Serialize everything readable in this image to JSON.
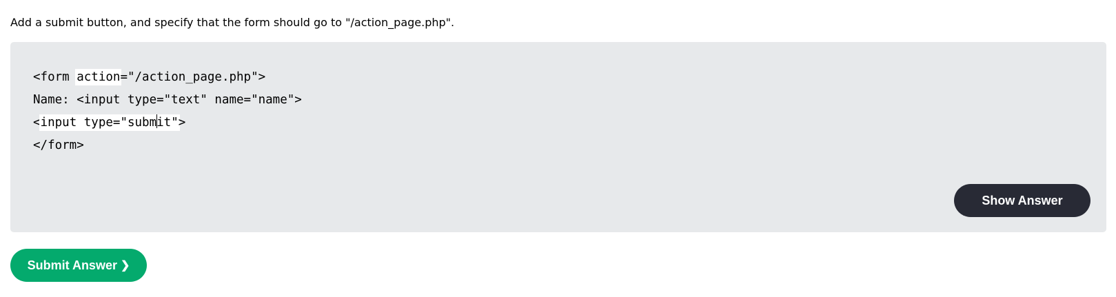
{
  "exercise": {
    "instruction": "Add a submit button, and specify that the form should go to \"/action_page.php\"."
  },
  "code": {
    "line1_start": "<form ",
    "input1_value": "action",
    "line1_end": "=\"/action_page.php\">",
    "line2": "Name: <input type=\"text\" name=\"name\">",
    "line3_start": "<",
    "input2_before_caret": "input type=\"subm",
    "input2_after_caret": "it\"",
    "line3_end": ">",
    "line4": "</form>"
  },
  "buttons": {
    "show_answer": "Show Answer",
    "submit_answer": "Submit Answer",
    "submit_chevron": "❯"
  },
  "colors": {
    "exercise_bg": "#e7e9eb",
    "show_answer_bg": "#282a35",
    "submit_bg": "#04aa6d"
  },
  "icons": {
    "submit_chevron": "chevron-right-icon"
  }
}
